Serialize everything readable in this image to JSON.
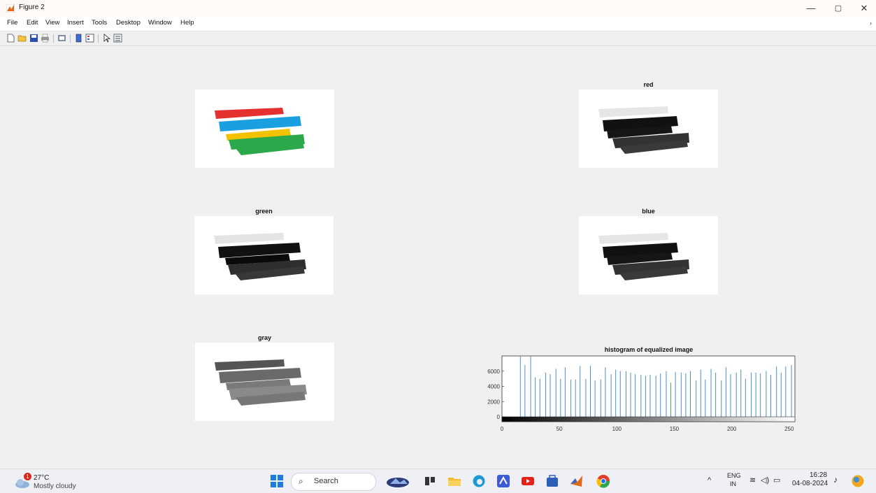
{
  "window": {
    "title": "Figure 2",
    "controls": {
      "minimize": "—",
      "restore": "▢",
      "close": "✕"
    }
  },
  "menu": {
    "items": [
      "File",
      "Edit",
      "View",
      "Insert",
      "Tools",
      "Desktop",
      "Window",
      "Help"
    ]
  },
  "toolbar": {
    "icons": [
      "new-figure-icon",
      "open-file-icon",
      "save-icon",
      "print-icon",
      "print-preview-icon",
      "colorbar-icon",
      "legend-icon",
      "pointer-icon",
      "property-inspector-icon"
    ]
  },
  "panels": {
    "original": {
      "title": ""
    },
    "red": {
      "title": "red"
    },
    "green": {
      "title": "green"
    },
    "blue": {
      "title": "blue"
    },
    "gray": {
      "title": "gray"
    }
  },
  "chart_data": {
    "type": "bar",
    "title": "histogram of equalized image",
    "xlabel": "",
    "ylabel": "",
    "xlim": [
      0,
      255
    ],
    "ylim": [
      0,
      8000
    ],
    "xticks": [
      0,
      50,
      100,
      150,
      200,
      250
    ],
    "yticks": [
      0,
      2000,
      4000,
      6000
    ],
    "x": [
      16,
      20,
      25,
      29,
      33,
      38,
      42,
      47,
      51,
      55,
      60,
      64,
      68,
      73,
      77,
      81,
      86,
      90,
      95,
      99,
      103,
      108,
      112,
      116,
      121,
      125,
      129,
      134,
      138,
      143,
      147,
      151,
      156,
      160,
      164,
      169,
      173,
      177,
      182,
      186,
      191,
      195,
      199,
      204,
      208,
      212,
      217,
      221,
      225,
      230,
      234,
      239,
      243,
      247,
      252
    ],
    "values": [
      8000,
      6800,
      8000,
      5200,
      5000,
      5800,
      5600,
      6300,
      5000,
      6500,
      4900,
      4900,
      6700,
      5000,
      6700,
      4800,
      4900,
      6500,
      5600,
      6200,
      6000,
      6000,
      5800,
      5600,
      5500,
      5400,
      5500,
      5400,
      5700,
      6000,
      4500,
      5900,
      5800,
      5700,
      6000,
      4800,
      6200,
      4900,
      6300,
      5800,
      4800,
      6500,
      5600,
      5800,
      6200,
      5000,
      5800,
      5800,
      5700,
      6000,
      5500,
      6600,
      5800,
      6600,
      6800
    ],
    "grid": false,
    "colorbar": "grayscale 0-255",
    "series_color": "#4a90c8"
  },
  "taskbar": {
    "weather": {
      "temp": "27°C",
      "condition": "Mostly cloudy",
      "badge": "1"
    },
    "search_label": "Search",
    "apps": [
      "start-icon",
      "search-icon",
      "photo-app-icon",
      "taskview-icon",
      "file-explorer-icon",
      "edge-icon",
      "app-icon",
      "youtube-icon",
      "store-icon",
      "matlab-icon",
      "chrome-icon"
    ],
    "lang": {
      "line1": "ENG",
      "line2": "IN"
    },
    "time": "16:28",
    "date": "04-08-2024"
  },
  "colors": {
    "red": "#e53030",
    "cyan": "#1aa0e0",
    "yellow": "#f2c200",
    "green": "#2aa84a",
    "hist_bar": "#4a90c8"
  }
}
